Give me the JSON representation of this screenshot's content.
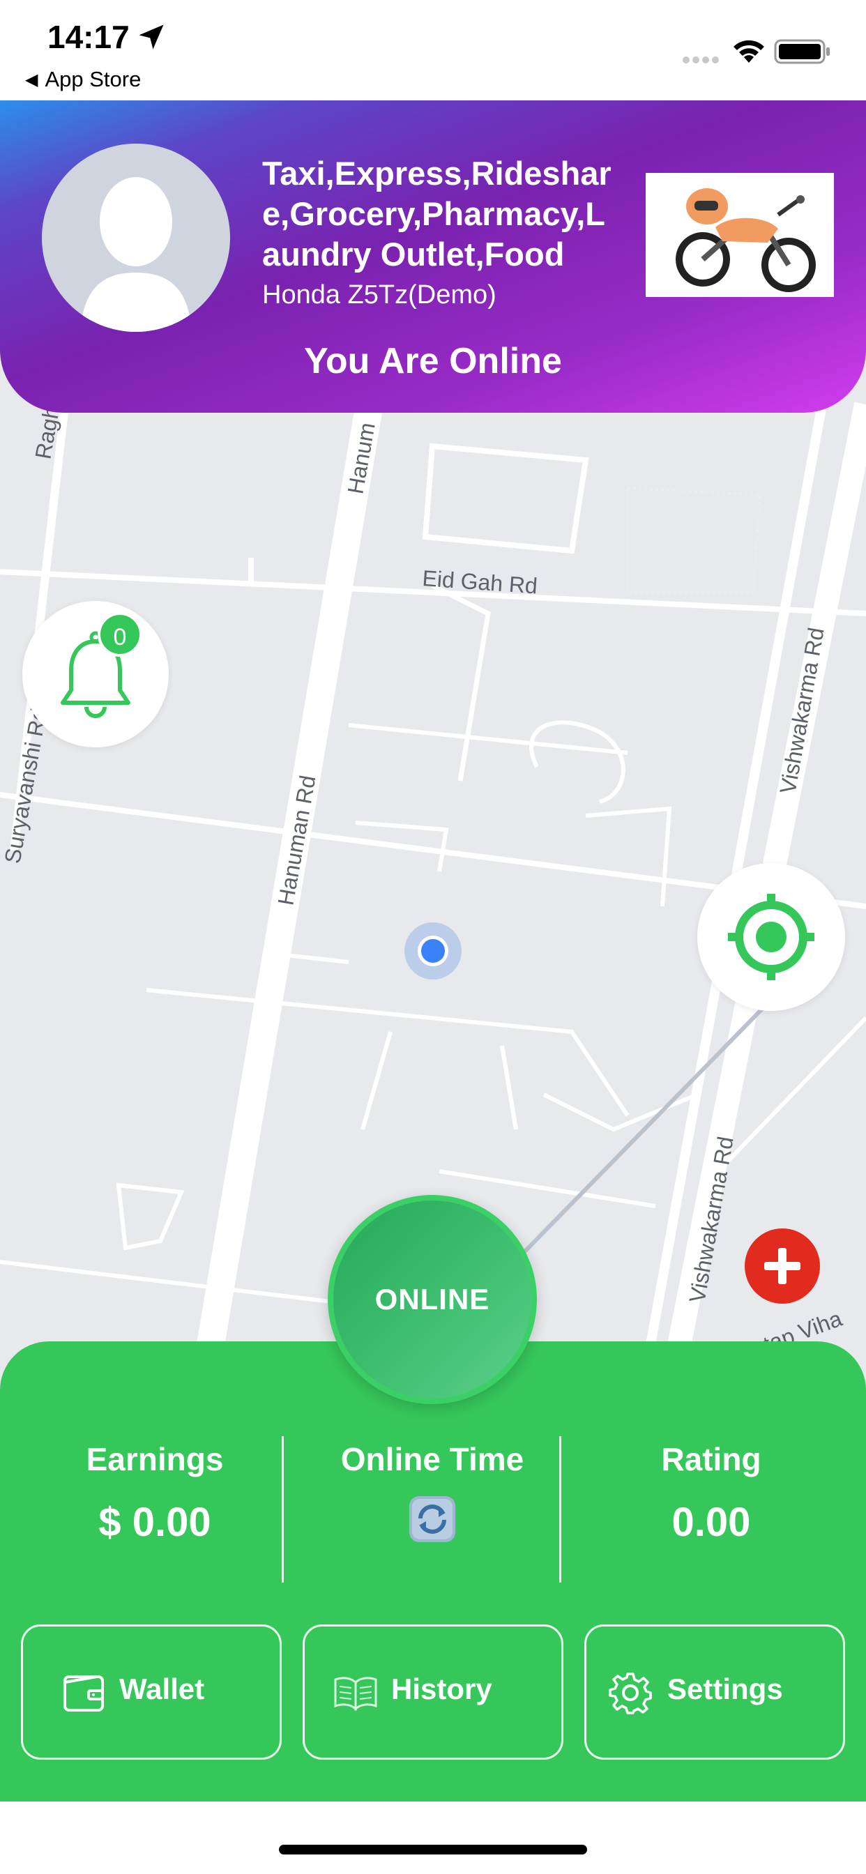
{
  "status_bar": {
    "time": "14:17",
    "back_app": "App Store",
    "icons": [
      "location-arrow-icon",
      "cellular-signal-icon",
      "wifi-icon",
      "battery-icon"
    ]
  },
  "header": {
    "services": "Taxi,Express,Rideshare,Grocery,Pharmacy,Laundry Outlet,Food",
    "vehicle": "Honda Z5Tz(Demo)",
    "online_status": "You Are Online",
    "gradient_colors": [
      "#2b8fec",
      "#7a22b0",
      "#d33cef"
    ]
  },
  "map": {
    "street_labels": [
      "Ragh",
      "Hanum",
      "Eid Gah Rd",
      "Vishwakarma Rd",
      "Hanuman Rd",
      "Vishwakarma Rd",
      "tap Viha",
      "Suryavanshi Rd"
    ],
    "notification_count": "0"
  },
  "online_button": {
    "label": "ONLINE"
  },
  "stats": {
    "earnings_label": "Earnings",
    "earnings_value": "$ 0.00",
    "online_time_label": "Online Time",
    "rating_label": "Rating",
    "rating_value": "0.00"
  },
  "actions": {
    "wallet": "Wallet",
    "history": "History",
    "settings": "Settings"
  },
  "colors": {
    "panel_green": "#36c75a",
    "badge_green": "#35c759",
    "add_red": "#e12b1f",
    "user_blue": "#3a82f7"
  }
}
